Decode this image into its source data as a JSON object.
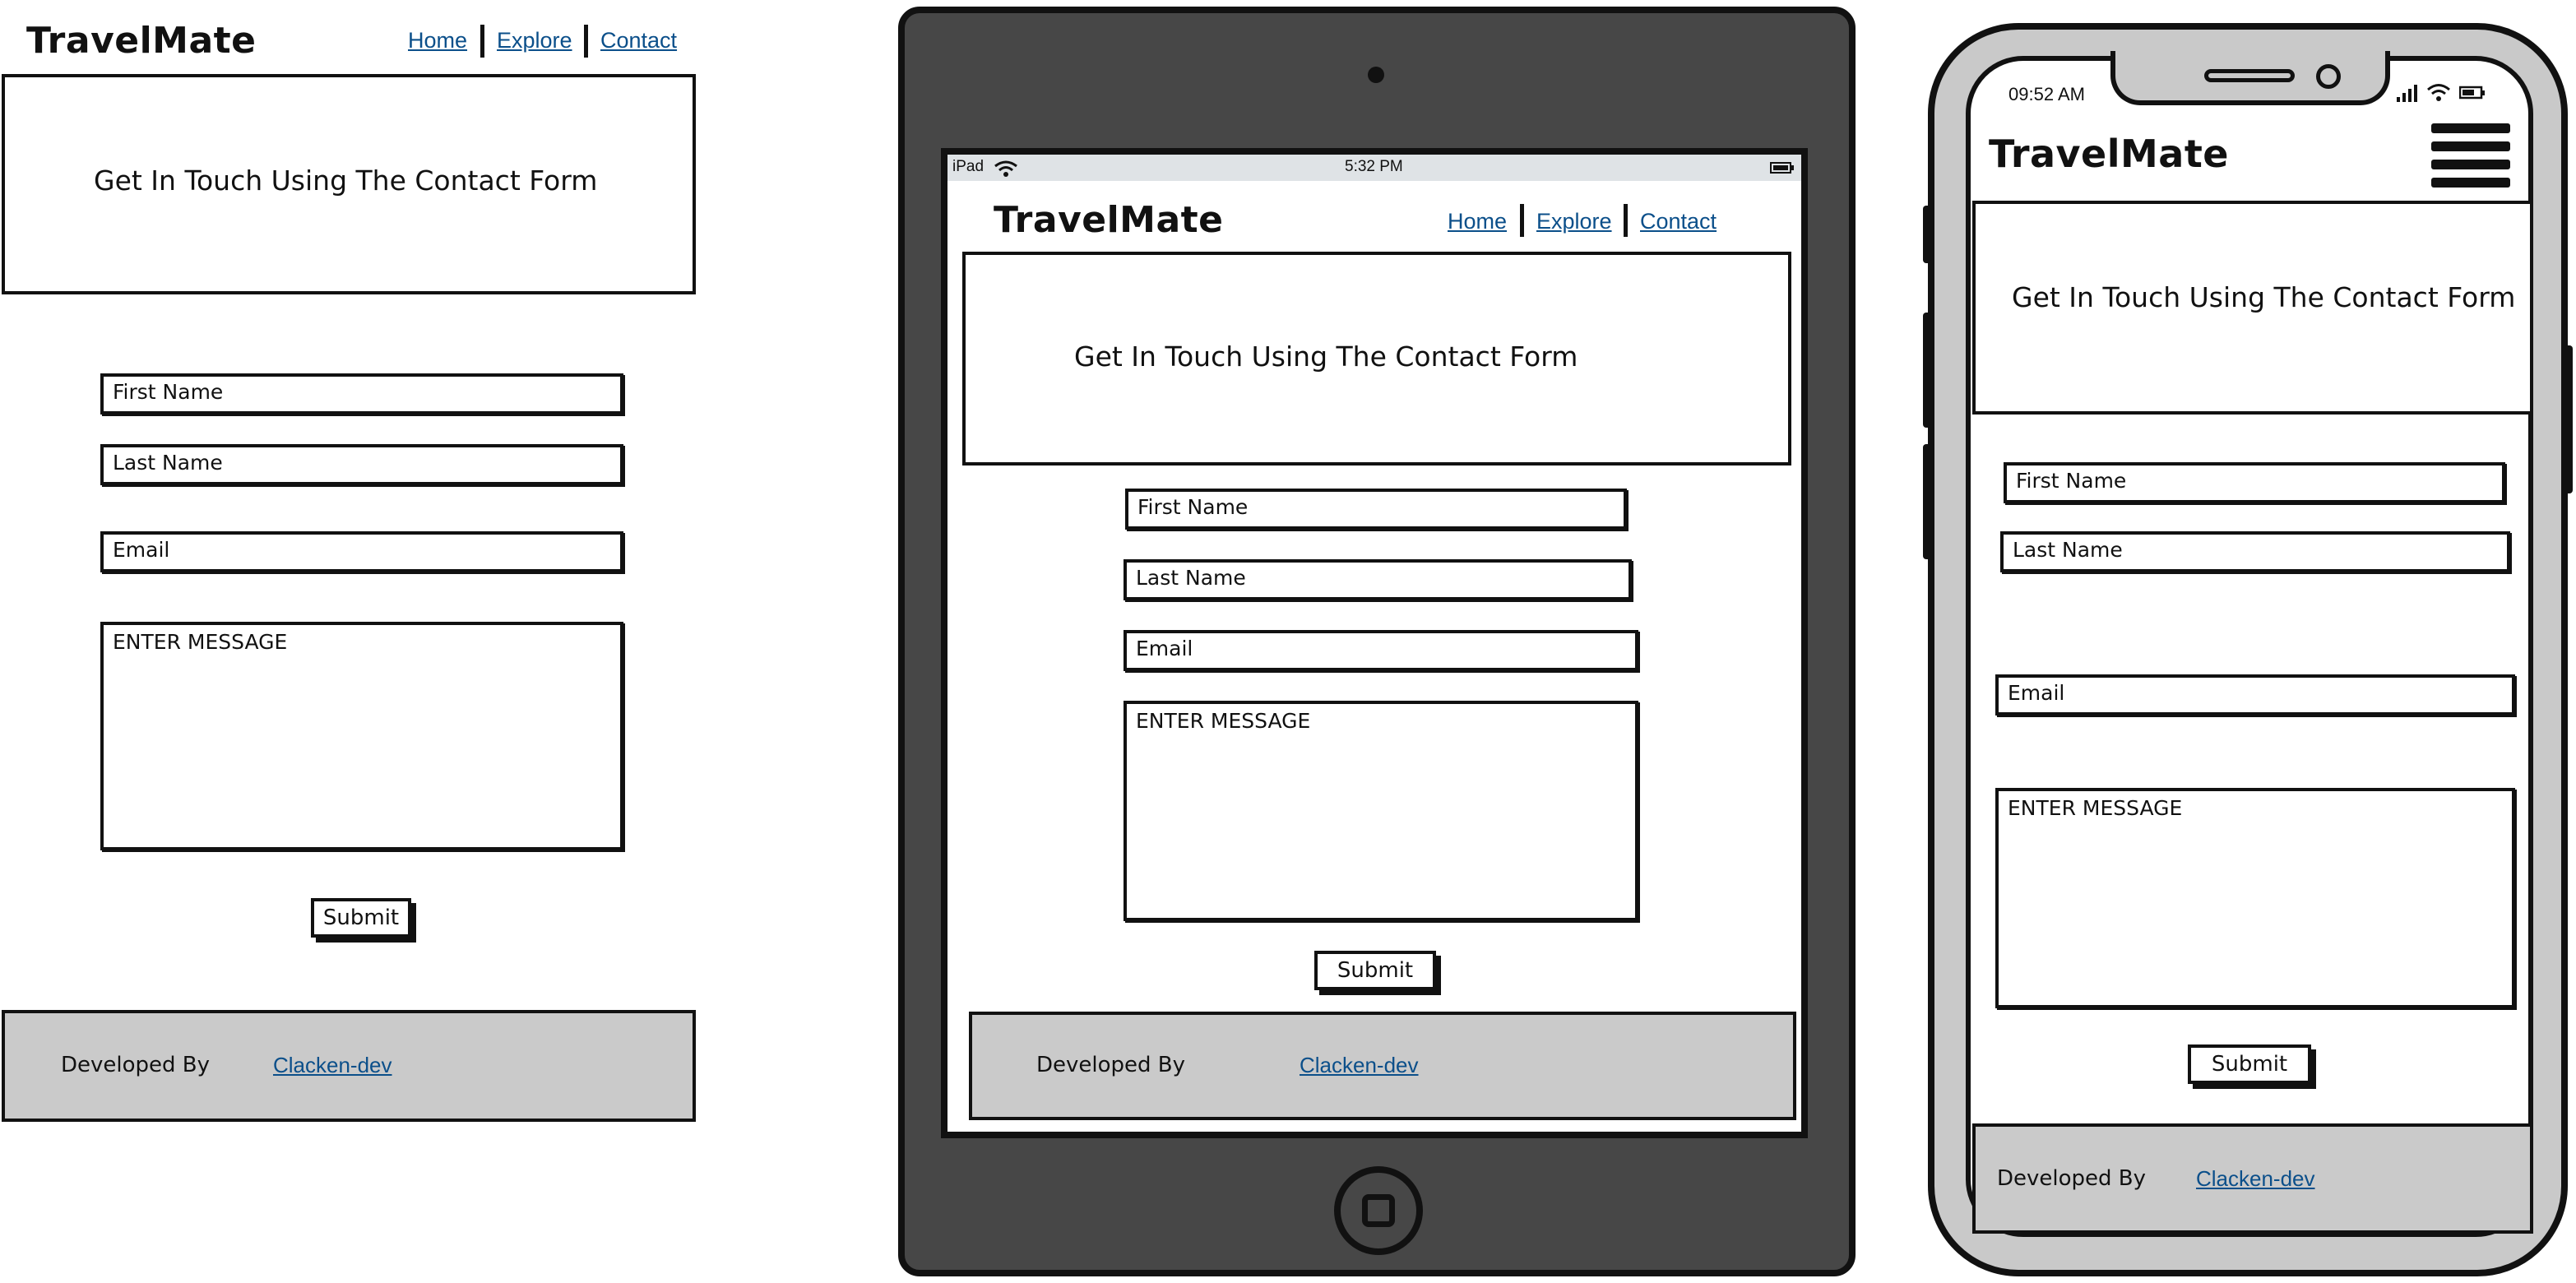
{
  "brand": {
    "name": "TravelMate"
  },
  "nav": {
    "home": "Home",
    "explore": "Explore",
    "contact": "Contact"
  },
  "hero": {
    "heading": "Get In Touch Using The Contact Form"
  },
  "form": {
    "first_name": "First Name",
    "last_name": "Last Name",
    "email": "Email",
    "message": "ENTER MESSAGE",
    "submit": "Submit"
  },
  "footer": {
    "developed_by": "Developed By",
    "developer_link": "Clacken-dev"
  },
  "tablet": {
    "device_label": "iPad",
    "time": "5:32 PM"
  },
  "phone": {
    "time": "09:52 AM"
  },
  "colors": {
    "link": "#0b4f8a",
    "footer_bg": "#cacaca",
    "tablet_body": "#474747",
    "phone_body": "#c9c9c9"
  },
  "icons": [
    "wifi-icon",
    "battery-icon",
    "signal-icon",
    "hamburger-menu-icon",
    "home-button-icon",
    "camera-icon"
  ]
}
